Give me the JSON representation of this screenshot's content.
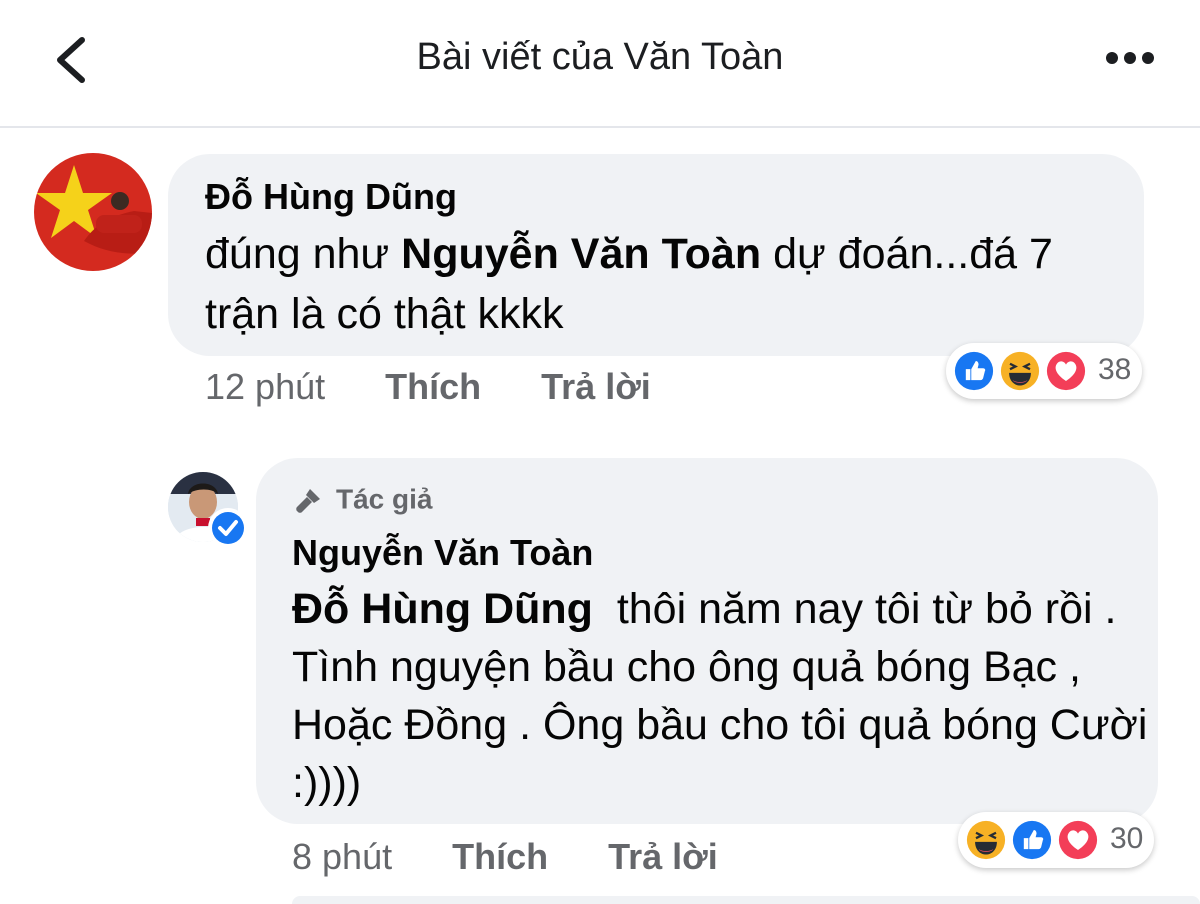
{
  "header": {
    "title": "Bài viết của Văn Toàn"
  },
  "comments": [
    {
      "author": "Đỗ Hùng Dũng",
      "body_before": "đúng như ",
      "mention": "Nguyễn Văn Toàn",
      "body_after": " dự đoán...đá 7 trận là có thật kkkk",
      "time": "12 phút",
      "like_label": "Thích",
      "reply_label": "Trả lời",
      "reactions": [
        "like-icon",
        "haha-icon",
        "love-icon"
      ],
      "reaction_count": "38"
    },
    {
      "author_tag": "Tác giả",
      "author": "Nguyễn Văn Toàn",
      "mention": "Đỗ Hùng Dũng",
      "body_after": "  thôi năm nay tôi từ bỏ rồi . Tình nguyện bầu cho ông quả bóng Bạc , Hoặc Đồng . Ông bầu cho tôi quả bóng Cười :))))",
      "time": "8 phút",
      "like_label": "Thích",
      "reply_label": "Trả lời",
      "reactions": [
        "haha-icon",
        "like-icon",
        "love-icon"
      ],
      "reaction_count": "30",
      "verified": true
    }
  ],
  "colors": {
    "bubble": "#f0f2f5",
    "secondary_text": "#65676b",
    "like": "#1877f2",
    "love": "#f33e58",
    "haha": "#f7b125",
    "verified": "#1877f2"
  }
}
